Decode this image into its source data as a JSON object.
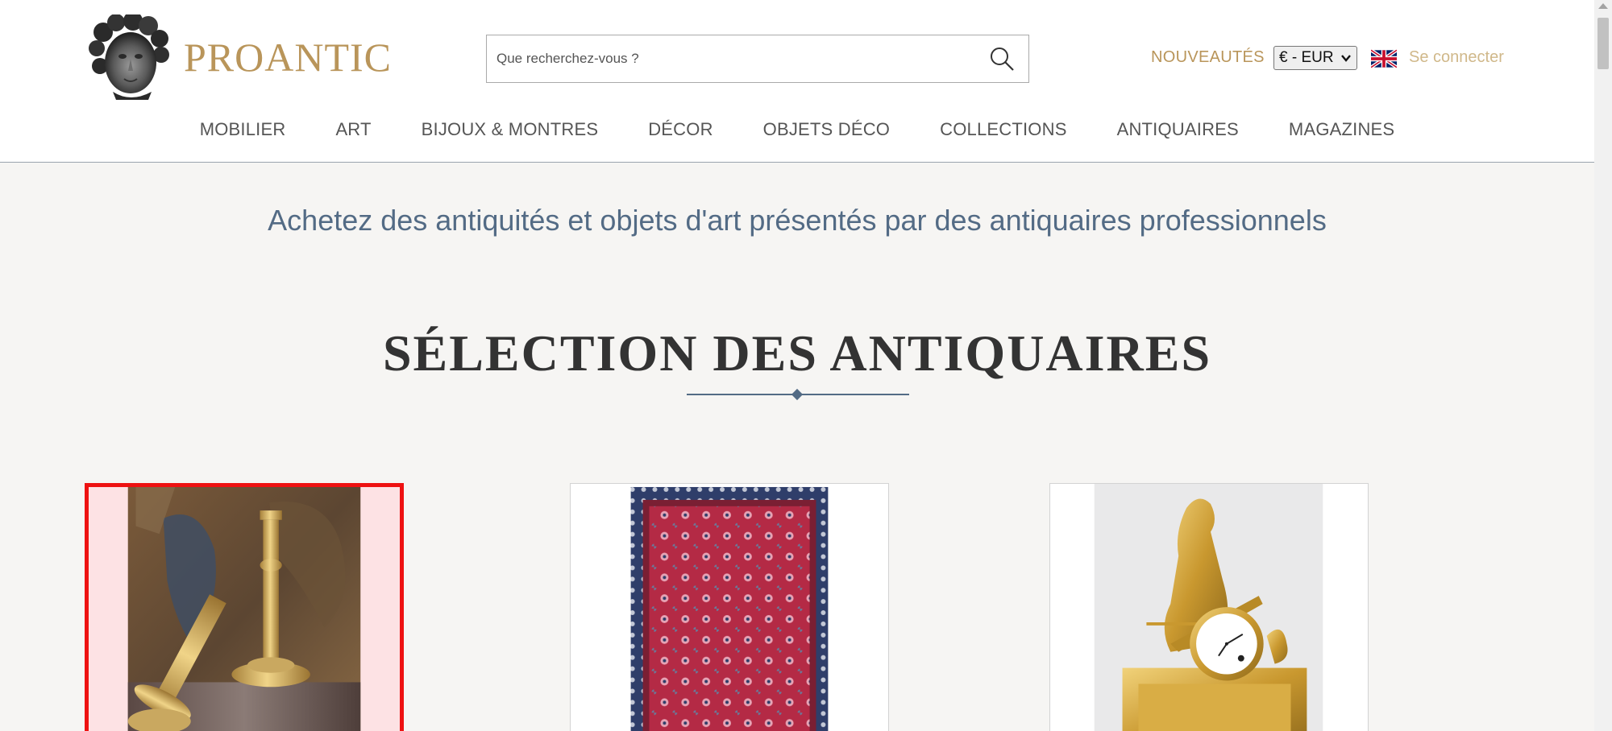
{
  "brand": {
    "name": "PROANTIC",
    "gold": "#b9955a"
  },
  "search": {
    "placeholder": "Que recherchez-vous ?"
  },
  "header_links": {
    "new": "NOUVEAUTÉS",
    "currency": "€ - EUR",
    "language_icon": "uk-flag-icon",
    "login": "Se connecter"
  },
  "nav": [
    {
      "label": "MOBILIER"
    },
    {
      "label": "ART"
    },
    {
      "label": "BIJOUX & MONTRES"
    },
    {
      "label": "DÉCOR"
    },
    {
      "label": "OBJETS DÉCO"
    },
    {
      "label": "COLLECTIONS"
    },
    {
      "label": "ANTIQUAIRES"
    },
    {
      "label": "MAGAZINES"
    }
  ],
  "tagline": "Achetez des antiquités et objets d'art présentés par des antiquaires professionnels",
  "section": {
    "title": "SÉLECTION DES ANTIQUAIRES"
  },
  "cards": [
    {
      "name": "gilt-bronze-candlesticks",
      "selected": true
    },
    {
      "name": "persian-rug",
      "selected": false
    },
    {
      "name": "gilt-bronze-mantel-clock",
      "selected": false
    }
  ],
  "colors": {
    "accent_blue": "#536b85",
    "selection_red": "#ee1111"
  }
}
